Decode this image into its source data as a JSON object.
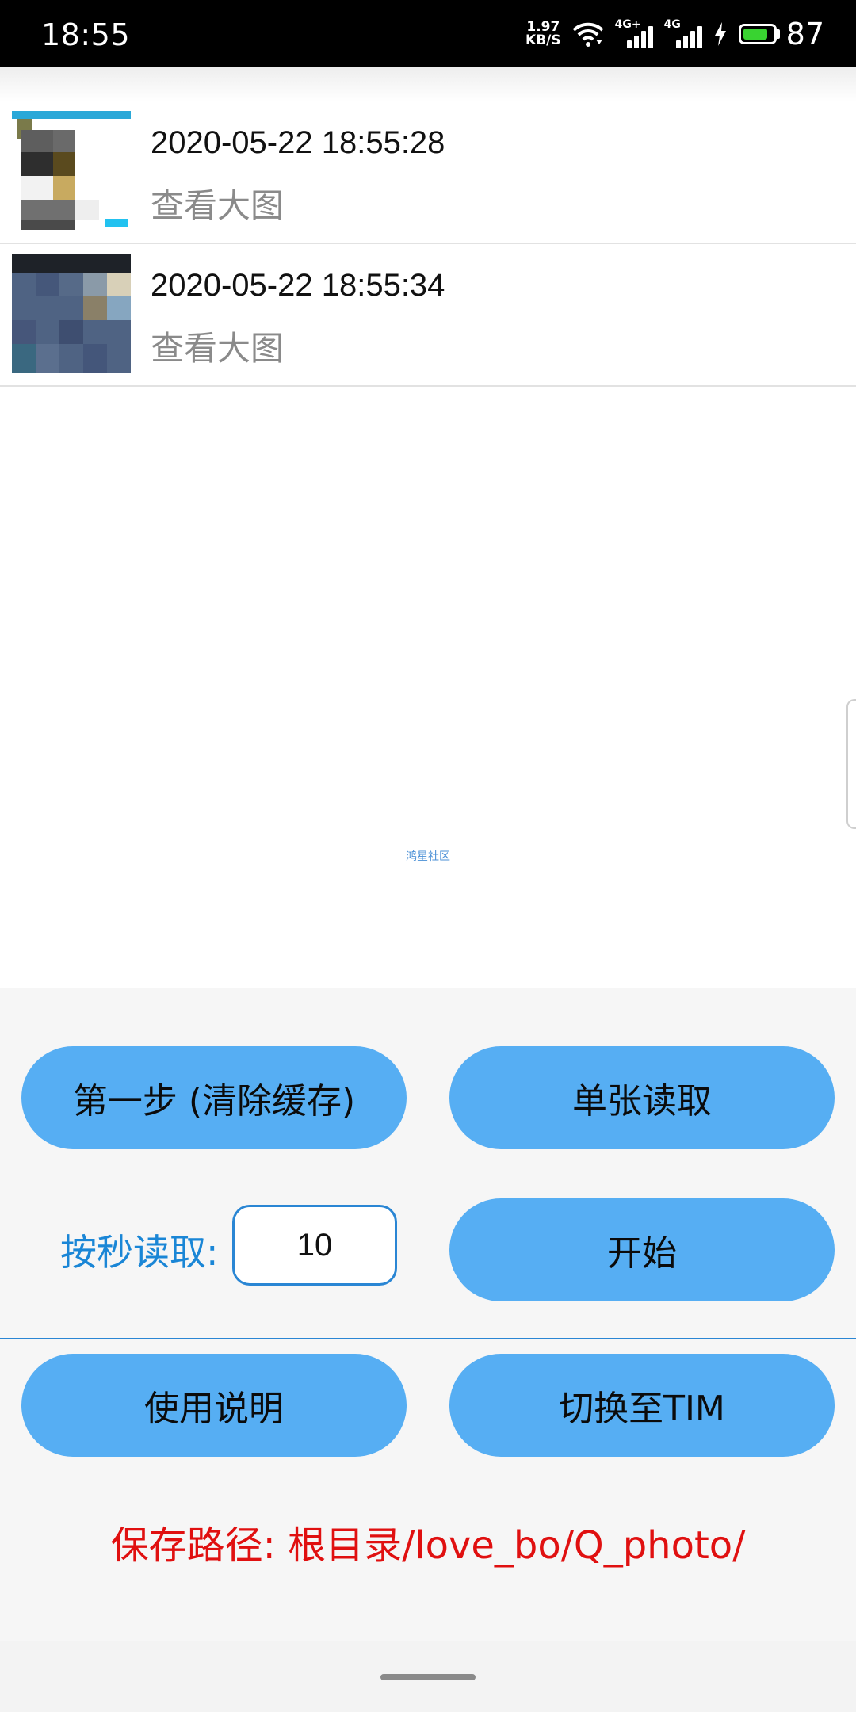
{
  "status_bar": {
    "time": "18:55",
    "speed_value": "1.97",
    "speed_unit": "KB/S",
    "net1_label": "4G+",
    "net2_label": "4G",
    "battery_level": "87",
    "battery_fraction": 0.87,
    "battery_color": "#39d331"
  },
  "photos": [
    {
      "timestamp": "2020-05-22 18:55:28",
      "action": "查看大图"
    },
    {
      "timestamp": "2020-05-22 18:55:34",
      "action": "查看大图"
    }
  ],
  "watermark": "鸿星社区",
  "controls": {
    "step_one_button": "第一步 (清除缓存)",
    "single_read_button": "单张读取",
    "seconds_label": "按秒读取:",
    "seconds_value": "10",
    "start_button": "开始",
    "instructions_button": "使用说明",
    "switch_tim_button": "切换至TIM"
  },
  "save_path": "保存路径: 根目录/love_bo/Q_photo/",
  "colors": {
    "button_bg": "#56aef3",
    "accent_blue": "#1a86d6",
    "save_path_red": "#e01010"
  }
}
